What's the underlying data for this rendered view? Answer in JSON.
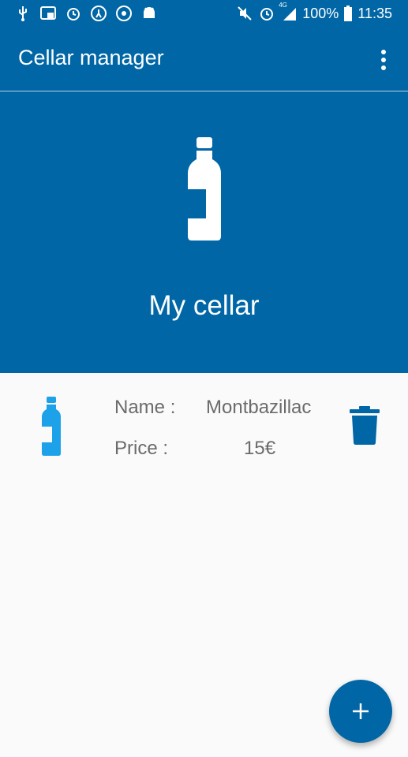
{
  "status_bar": {
    "left_icons": [
      "usb-icon",
      "image-notification-icon",
      "alarm-icon",
      "activity-icon",
      "location-icon",
      "android-debug-icon"
    ],
    "right_icons": [
      "mute-icon",
      "alarm-icon",
      "signal-4g-icon",
      "battery-icon"
    ],
    "network_label": "4G",
    "battery": "100%",
    "time": "11:35"
  },
  "app_bar": {
    "title": "Cellar manager",
    "overflow_icon": "more-vert-icon"
  },
  "header": {
    "icon": "bottle-icon",
    "title": "My cellar"
  },
  "items": [
    {
      "icon": "bottle-icon",
      "name_label": "Name :",
      "name_value": "Montbazillac",
      "price_label": "Price :",
      "price_value": "15€",
      "delete_icon": "trash-icon"
    }
  ],
  "fab": {
    "icon": "plus-icon",
    "symbol": "+"
  },
  "colors": {
    "primary": "#0066a6",
    "accent_bottle": "#1da1e8",
    "background": "#fafafa",
    "text_secondary": "#6b6b6b"
  }
}
